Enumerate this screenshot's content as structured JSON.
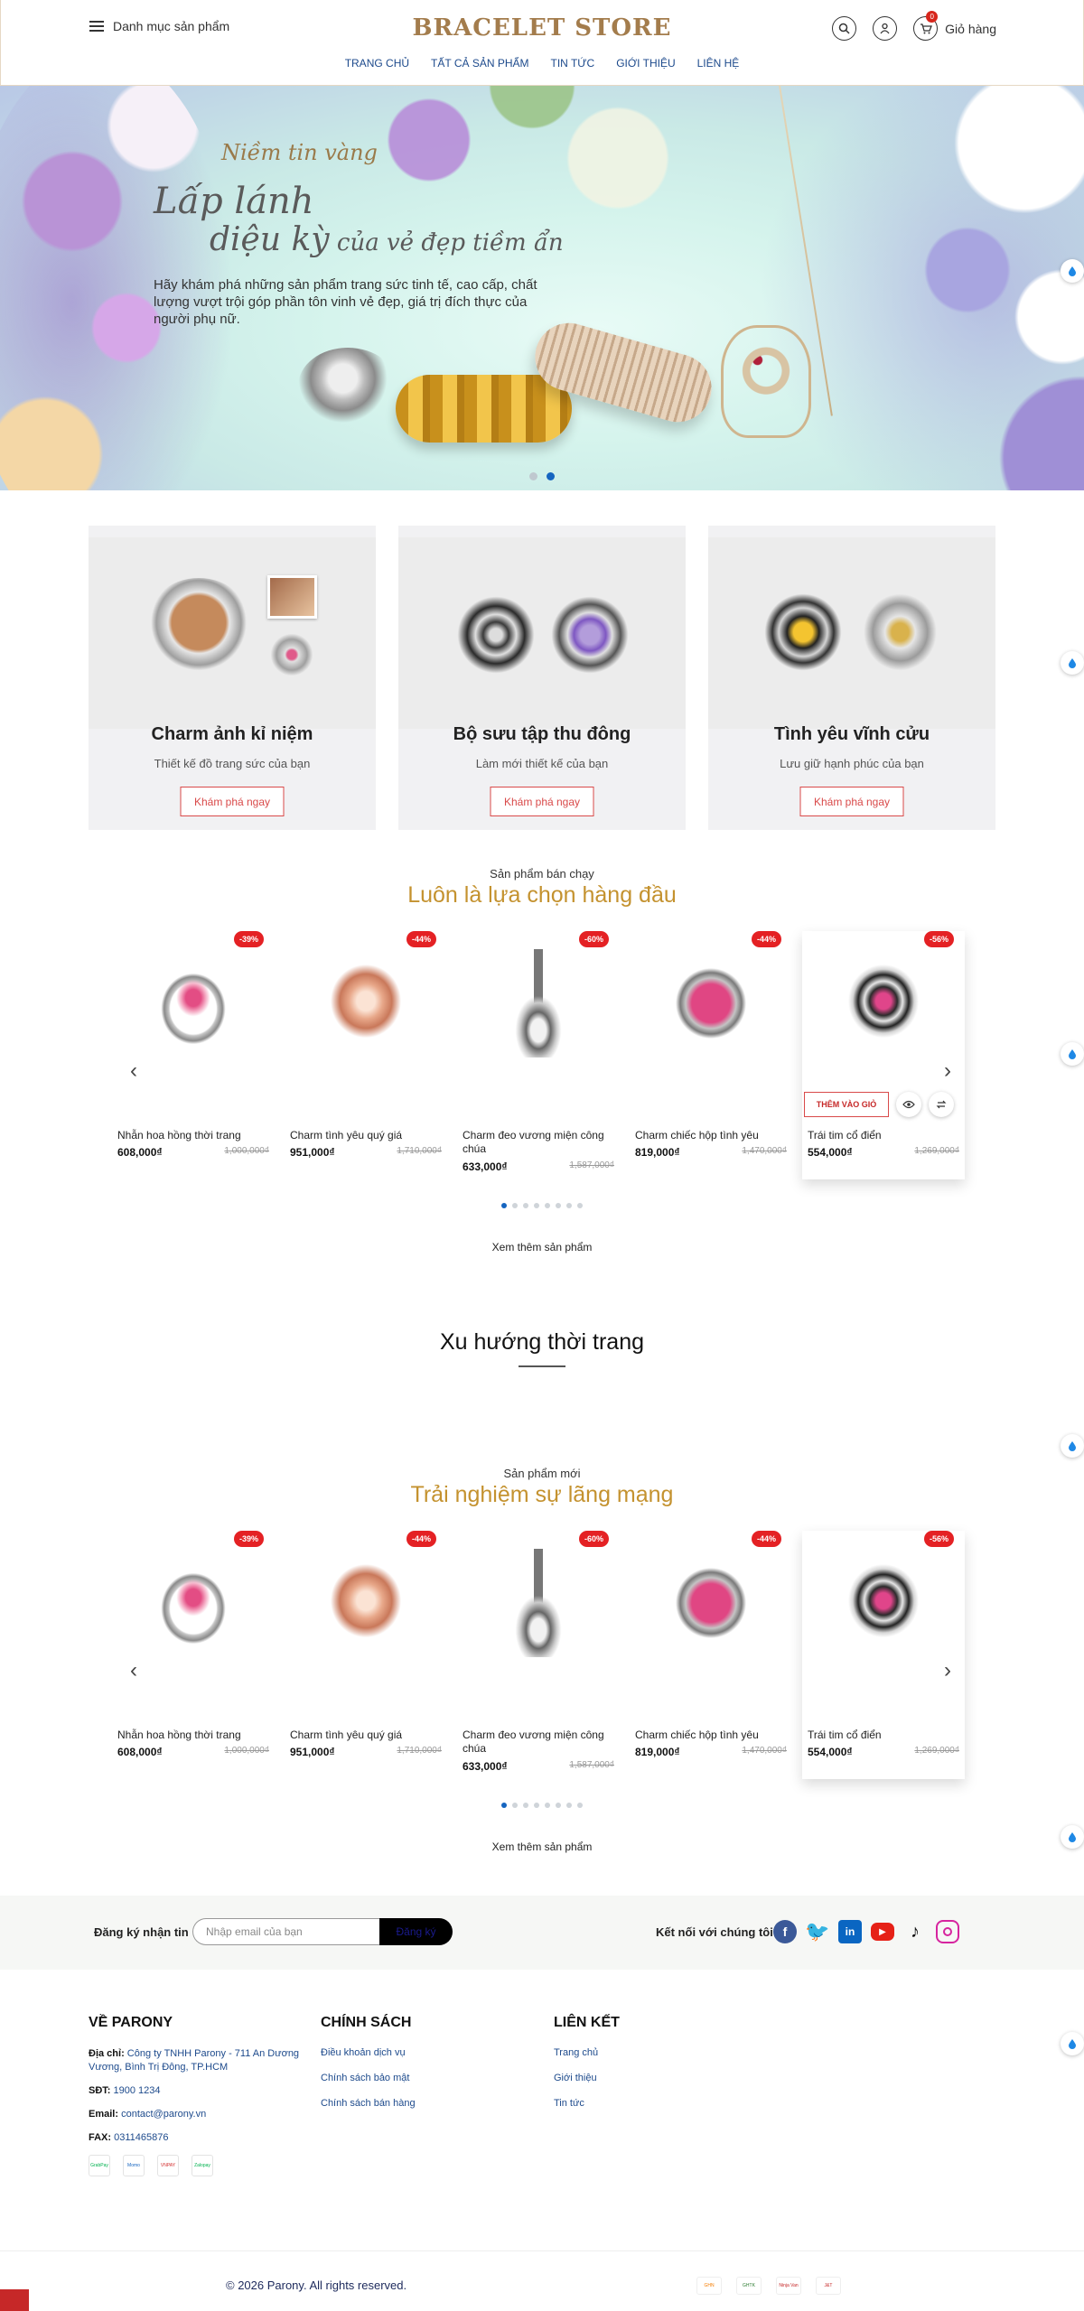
{
  "header": {
    "menu_label": "Danh mục sản phẩm",
    "logo": "BRACELET STORE",
    "cart_label": "Giỏ hàng",
    "cart_count": "0",
    "nav": [
      "TRANG CHỦ",
      "TẤT CẢ SẢN PHẨM",
      "TIN TỨC",
      "GIỚI THIỆU",
      "LIÊN HỆ"
    ]
  },
  "hero": {
    "tag": "Niềm tin vàng",
    "title_line1": "Lấp lánh",
    "title_line2a": "diệu kỳ",
    "title_line2b": " của vẻ đẹp tiềm ẩn",
    "description": "Hãy khám phá những sản phẩm trang sức tinh tế, cao cấp, chất lượng vượt trội góp phần tôn vinh vẻ đẹp, giá trị đích thực của người phụ nữ.",
    "slides": 2,
    "active_slide": 2
  },
  "banners": [
    {
      "title": "Charm ảnh kỉ niệm",
      "subtitle": "Thiết kế đồ trang sức của bạn",
      "button": "Khám phá ngay"
    },
    {
      "title": "Bộ sưu tập thu đông",
      "subtitle": "Làm mới thiết kế của bạn",
      "button": "Khám phá ngay"
    },
    {
      "title": "Tình yêu vĩnh cửu",
      "subtitle": "Lưu giữ hạnh phúc của bạn",
      "button": "Khám phá ngay"
    }
  ],
  "bestsellers": {
    "small_title": "Sản phẩm bán chạy",
    "big_title": "Luôn là lựa chọn hàng đầu",
    "more": "Xem thêm sản phẩm",
    "add_to_cart": "THÊM VÀO GIỎ"
  },
  "trend": {
    "title": "Xu hướng thời trang"
  },
  "newproducts": {
    "small_title": "Sản phẩm mới",
    "big_title": "Trải nghiệm sự lãng mạng",
    "more": "Xem thêm sản phẩm"
  },
  "products": [
    {
      "name": "Nhẫn hoa hồng thời trang",
      "price": "608,000₫",
      "old_price": "1,000,000₫",
      "discount": "-39%"
    },
    {
      "name": "Charm tình yêu quý giá",
      "price": "951,000₫",
      "old_price": "1,710,000₫",
      "discount": "-44%"
    },
    {
      "name": "Charm đeo vương miện công chúa",
      "price": "633,000₫",
      "old_price": "1,587,000₫",
      "discount": "-60%"
    },
    {
      "name": "Charm chiếc hộp tình yêu",
      "price": "819,000₫",
      "old_price": "1,470,000₫",
      "discount": "-44%"
    },
    {
      "name": "Trái tim cổ điển",
      "price": "554,000₫",
      "old_price": "1,269,000₫",
      "discount": "-56%"
    }
  ],
  "newsletter": {
    "label": "Đăng ký nhận tin",
    "placeholder": "Nhập email của bạn",
    "button": "Đăng ký",
    "connect": "Kết nối với chúng tôi"
  },
  "footer": {
    "about_title": "VỀ PARONY",
    "address_label": "Địa chỉ:",
    "address": "Công ty TNHH Parony - 711 An Dương Vương, Bình Trị Đông, TP.HCM",
    "phone_label": "SĐT:",
    "phone": "1900 1234",
    "email_label": "Email:",
    "email": "contact@parony.vn",
    "fax_label": "FAX:",
    "fax": "0311465876",
    "policy_title": "CHÍNH SÁCH",
    "policies": [
      "Điều khoản dịch vụ",
      "Chính sách bảo mật",
      "Chính sách bán hàng"
    ],
    "links_title": "LIÊN KẾT",
    "links": [
      "Trang chủ",
      "Giới thiệu",
      "Tin tức"
    ],
    "payments": [
      "GrabPay",
      "Momo",
      "VNPAY",
      "Zalopay"
    ],
    "shipping": [
      "GHN",
      "GHTK",
      "Ninja Van",
      "J&T"
    ],
    "copyright": "© 2026 Parony. All rights reserved."
  },
  "colors": {
    "accent_gold": "#c4922f",
    "logo": "#a37c4c",
    "sale_red": "#e42124",
    "link_blue": "#1d4a8c"
  }
}
